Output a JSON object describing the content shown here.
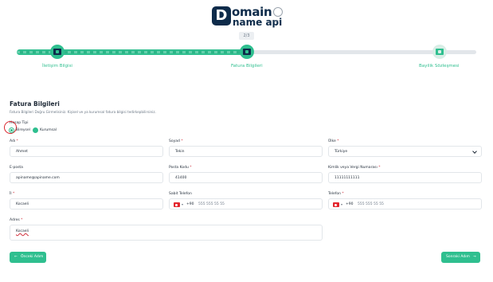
{
  "brand": {
    "logo_top": "omain",
    "logo_bottom": "name api",
    "logo_letter": "D",
    "icann": "ICANN"
  },
  "progress": {
    "step_indicator": "2/3",
    "fraction": 0.5,
    "steps": [
      {
        "label": "İletişim Bilgisi",
        "state": "done"
      },
      {
        "label": "Fatura Bilgileri",
        "state": "active"
      },
      {
        "label": "Bayilik Sözleşmesi",
        "state": "pending"
      }
    ]
  },
  "form": {
    "title": "Fatura Bilgileri",
    "description": "Fatura Bilgileri Doğru Girmelisiniz. Kişisel ve ya kurumsal fatura bilgisi tedirkepbilirsiniz.",
    "account_type_label": "Hesap Tipi",
    "account_types": [
      "Bireysel",
      "Kurumsal"
    ],
    "selected_account_type": "Bireysel",
    "fields": {
      "ad": {
        "label": "Adı",
        "value": "Ahmet"
      },
      "soyad": {
        "label": "Soyad",
        "value": "Tekin"
      },
      "ulke": {
        "label": "Ülke",
        "value": "Türkiye"
      },
      "eposta": {
        "label": "E-posta",
        "value": "apiname@apiname.com"
      },
      "posta": {
        "label": "Posta Kodu",
        "value": "41400"
      },
      "tckn": {
        "label": "Kimlik veya Vergi Numarası",
        "value": "11111111111"
      },
      "il": {
        "label": "İl",
        "value": "Kocaeli"
      },
      "sabit": {
        "label": "Sabit Telefon",
        "code": "+90",
        "value": "555 555 55 55"
      },
      "telefon": {
        "label": "Telefon",
        "code": "+90",
        "value": "555 555 55 55"
      },
      "adres": {
        "label": "Adres",
        "value": "Kocaeli"
      }
    },
    "required_mark": "*",
    "prev_button": "Önceki Adım",
    "next_button": "Sonraki Adım",
    "prev_arrow": "←",
    "next_arrow": "→"
  },
  "colors": {
    "accent": "#2fbf8f",
    "brand_dark": "#0e2b4a",
    "error": "#d9262e"
  }
}
